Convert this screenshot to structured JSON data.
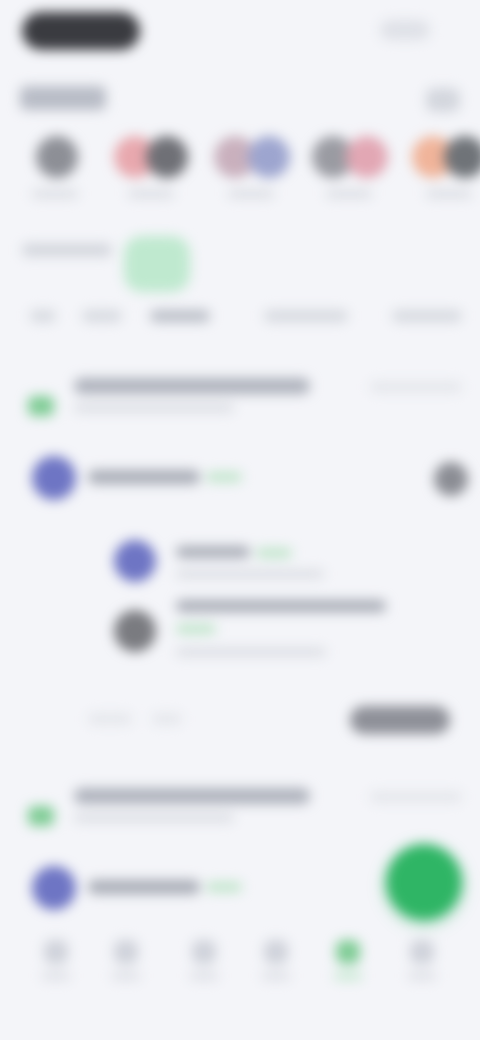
{
  "colors": {
    "background": "#f4f5f9",
    "accent_green": "#2fb565",
    "avatar_blue": "#6e75c4",
    "dark_pill": "#3a3b40"
  },
  "header": {
    "icon_names": [
      "top-pill",
      "menu-icon"
    ]
  },
  "stories": {
    "count": 5
  },
  "posts": {
    "count": 2
  },
  "fab": {
    "icon": "plus-icon"
  },
  "bottom_nav": {
    "items": [
      {
        "icon": "home-icon"
      },
      {
        "icon": "chat-icon"
      },
      {
        "icon": "explore-icon"
      },
      {
        "icon": "bell-icon"
      },
      {
        "icon": "green-active-icon"
      },
      {
        "icon": "profile-icon"
      }
    ]
  }
}
